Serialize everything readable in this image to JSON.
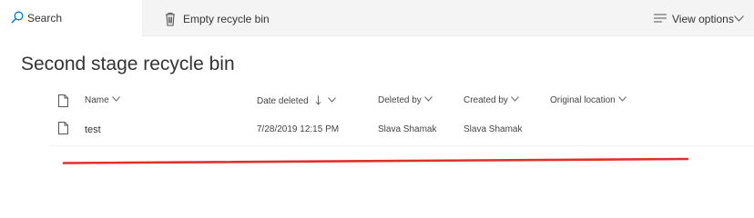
{
  "command_bar": {
    "search_label": "Search",
    "empty_bin_label": "Empty recycle bin",
    "view_options_label": "View options"
  },
  "page": {
    "title": "Second stage recycle bin"
  },
  "columns": {
    "name": "Name",
    "date_deleted": "Date deleted",
    "deleted_by": "Deleted by",
    "created_by": "Created by",
    "original_location": "Original location"
  },
  "rows": [
    {
      "name": "test",
      "date_deleted": "7/28/2019 12:15 PM",
      "deleted_by": "Slava Shamak",
      "created_by": "Slava Shamak",
      "original_location": ""
    }
  ],
  "colors": {
    "accent": "#0078d4",
    "annotation_red": "#e0302c"
  }
}
